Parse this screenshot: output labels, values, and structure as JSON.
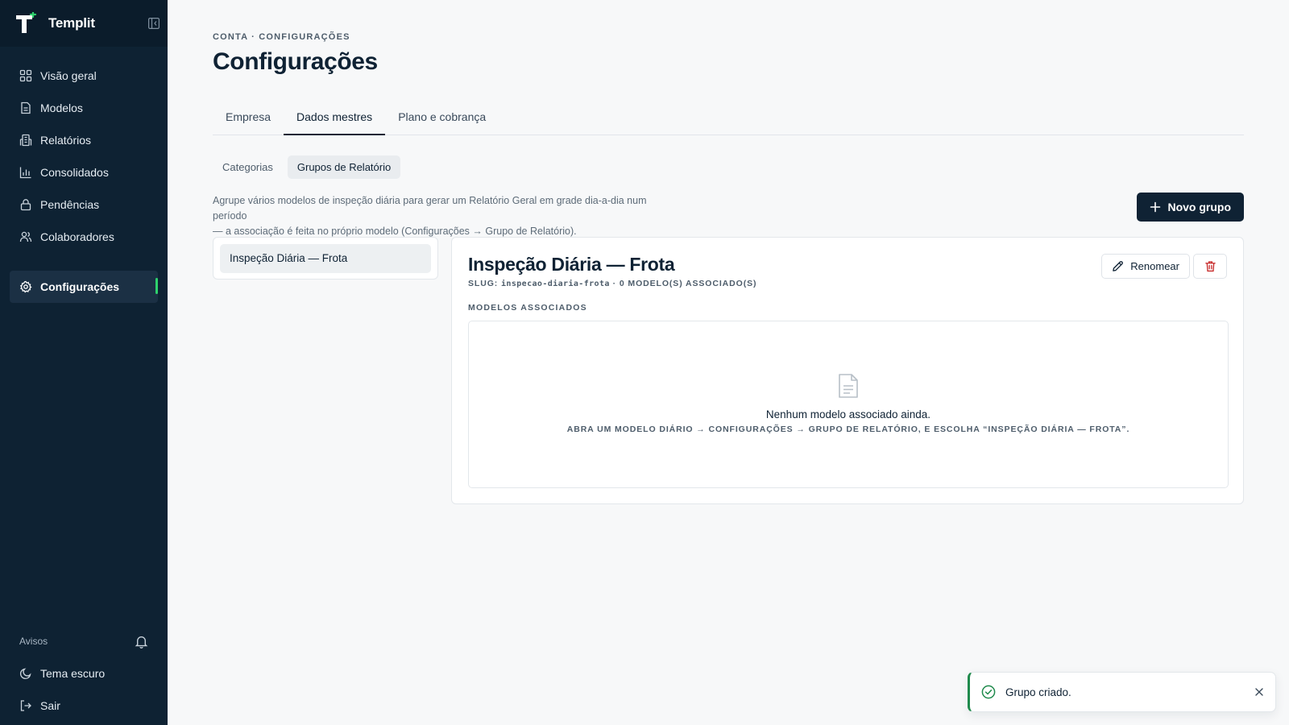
{
  "app": {
    "name": "Templit"
  },
  "nav": {
    "items": [
      {
        "label": "Visão geral",
        "icon": "grid-icon"
      },
      {
        "label": "Modelos",
        "icon": "document-icon"
      },
      {
        "label": "Relatórios",
        "icon": "building-icon"
      },
      {
        "label": "Consolidados",
        "icon": "bar-chart-icon"
      },
      {
        "label": "Pendências",
        "icon": "lock-icon"
      },
      {
        "label": "Colaboradores",
        "icon": "users-icon"
      }
    ],
    "active": {
      "label": "Configurações",
      "icon": "gear-icon"
    }
  },
  "sidebar_bottom": {
    "notices_label": "Avisos",
    "dark_theme_label": "Tema escuro",
    "logout_label": "Sair"
  },
  "page": {
    "breadcrumb": "CONTA · CONFIGURAÇÕES",
    "title": "Configurações"
  },
  "tabs": [
    {
      "label": "Empresa",
      "active": false
    },
    {
      "label": "Dados mestres",
      "active": true
    },
    {
      "label": "Plano e cobrança",
      "active": false
    }
  ],
  "subtabs": [
    {
      "label": "Categorias",
      "active": false
    },
    {
      "label": "Grupos de Relatório",
      "active": true
    }
  ],
  "description": {
    "line1": "Agrupe vários modelos de inspeção diária para gerar um Relatório Geral em grade dia-a-dia num período",
    "line2": "— a associação é feita no próprio modelo (Configurações → Grupo de Relatório)."
  },
  "new_group_button": "Novo grupo",
  "groups": [
    "Inspeção Diária — Frota"
  ],
  "detail": {
    "title": "Inspeção Diária — Frota",
    "slug_prefix": "SLUG: ",
    "slug": "inspecao-diaria-frota",
    "count_text": " · 0 MODELO(S) ASSOCIADO(S)",
    "rename_label": "Renomear",
    "section_label": "MODELOS ASSOCIADOS",
    "empty_title": "Nenhum modelo associado ainda.",
    "empty_hint": "ABRA UM MODELO DIÁRIO → CONFIGURAÇÕES → GRUPO DE RELATÓRIO, E ESCOLHA “INSPEÇÃO DIÁRIA — FROTA”."
  },
  "toast": {
    "message": "Grupo criado."
  },
  "colors": {
    "sidebar_bg": "#0e2233",
    "primary": "#0f2234",
    "accent_green": "#2ed16d",
    "success": "#1f8a4c",
    "danger": "#c62828"
  }
}
